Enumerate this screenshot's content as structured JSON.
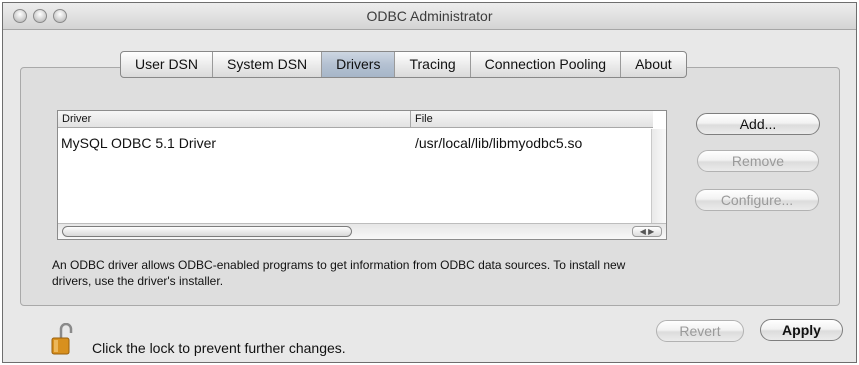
{
  "window": {
    "title": "ODBC Administrator"
  },
  "tabs": [
    {
      "label": "User DSN",
      "selected": false
    },
    {
      "label": "System DSN",
      "selected": false
    },
    {
      "label": "Drivers",
      "selected": true
    },
    {
      "label": "Tracing",
      "selected": false
    },
    {
      "label": "Connection Pooling",
      "selected": false
    },
    {
      "label": "About",
      "selected": false
    }
  ],
  "drivers_table": {
    "columns": {
      "driver": "Driver",
      "file": "File"
    },
    "rows": [
      {
        "driver": "MySQL ODBC 5.1 Driver",
        "file": "/usr/local/lib/libmyodbc5.so"
      }
    ]
  },
  "buttons": {
    "add": "Add...",
    "remove": "Remove",
    "configure": "Configure...",
    "revert": "Revert",
    "apply": "Apply"
  },
  "description": "An ODBC driver allows ODBC-enabled programs to get information from ODBC data sources. To install new drivers, use the driver's installer.",
  "footer": {
    "lock_text": "Click the lock to prevent further changes.",
    "lock_icon": "padlock-open-icon"
  },
  "colors": {
    "selected_tab": "#b4c1d2",
    "window_bg": "#e8e8e8"
  }
}
